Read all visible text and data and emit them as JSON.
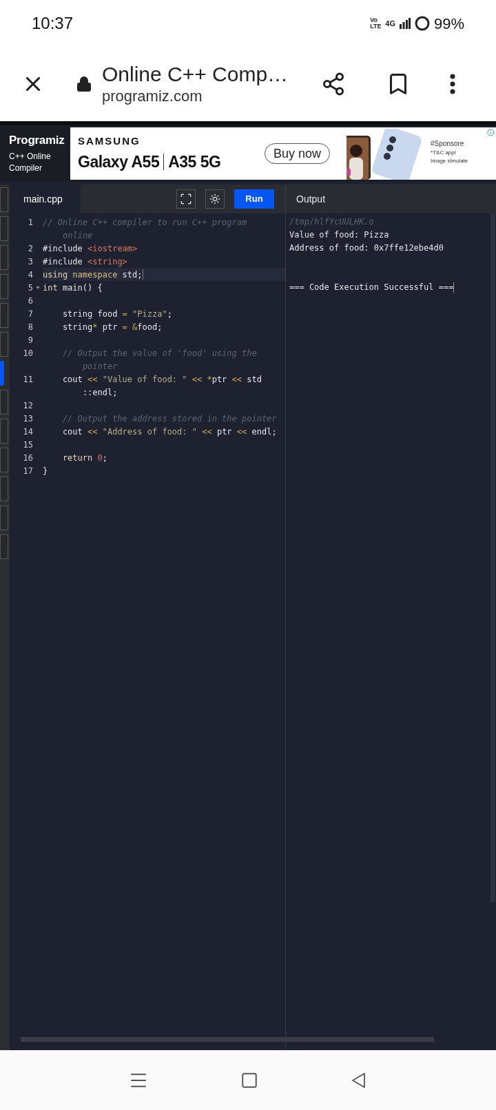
{
  "status_bar": {
    "time": "10:37",
    "volte": "Vo LTE",
    "network": "4G",
    "battery": "99%"
  },
  "browser_bar": {
    "title": "Online C++ Comp…",
    "url": "programiz.com"
  },
  "site_header": {
    "logo": "Programiz",
    "subtitle": "C++ Online Compiler"
  },
  "ad": {
    "brand": "SAMSUNG",
    "model_1": "Galaxy A55",
    "model_2": "A35 5G",
    "button": "Buy now",
    "sponsored": "#Sponsore",
    "terms": "*T&C appl",
    "note": "Image simulate"
  },
  "side_tabs": [
    {
      "selected": false
    },
    {
      "selected": false
    },
    {
      "selected": false
    },
    {
      "selected": false
    },
    {
      "selected": false
    },
    {
      "selected": false
    },
    {
      "selected": true
    },
    {
      "selected": false
    },
    {
      "selected": false
    },
    {
      "selected": false
    },
    {
      "selected": false
    },
    {
      "selected": false
    },
    {
      "selected": false
    }
  ],
  "tabs": [
    {
      "label": "main.cpp",
      "selected": true
    }
  ],
  "run_button": "Run",
  "code_rows": [
    {
      "kind": "line",
      "number": "1",
      "active": false,
      "foldable": false,
      "tokens": [
        {
          "kind": "comment",
          "text": "// Online C++ compiler to run C++ program"
        }
      ]
    },
    {
      "kind": "wrap",
      "active": false,
      "foldable": false,
      "tokens": [
        {
          "kind": "comment",
          "text": "online"
        }
      ]
    },
    {
      "kind": "line",
      "number": "2",
      "active": false,
      "foldable": false,
      "tokens": [
        {
          "kind": "plain",
          "text": "#include "
        },
        {
          "kind": "include",
          "text": "<iostream>"
        }
      ]
    },
    {
      "kind": "line",
      "number": "3",
      "active": false,
      "foldable": false,
      "tokens": [
        {
          "kind": "plain",
          "text": "#include "
        },
        {
          "kind": "include",
          "text": "<string>"
        }
      ]
    },
    {
      "kind": "line",
      "number": "4",
      "active": true,
      "foldable": false,
      "tokens": [
        {
          "kind": "keyword",
          "text": "using "
        },
        {
          "kind": "type",
          "text": "namespace "
        },
        {
          "kind": "plain",
          "text": "std;"
        }
      ]
    },
    {
      "kind": "line",
      "number": "5",
      "active": false,
      "foldable": true,
      "tokens": [
        {
          "kind": "keyword",
          "text": "int "
        },
        {
          "kind": "plain",
          "text": "main() {"
        }
      ]
    },
    {
      "kind": "line",
      "number": "6",
      "active": false,
      "foldable": false,
      "tokens": []
    },
    {
      "kind": "line",
      "number": "7",
      "active": false,
      "foldable": false,
      "tokens": [
        {
          "kind": "plain",
          "text": "    string food "
        },
        {
          "kind": "operator",
          "text": "= "
        },
        {
          "kind": "string",
          "text": "\"Pizza\""
        },
        {
          "kind": "plain",
          "text": ";"
        }
      ]
    },
    {
      "kind": "line",
      "number": "8",
      "active": false,
      "foldable": false,
      "tokens": [
        {
          "kind": "plain",
          "text": "    string"
        },
        {
          "kind": "operator",
          "text": "*"
        },
        {
          "kind": "plain",
          "text": " ptr "
        },
        {
          "kind": "operator",
          "text": "= &"
        },
        {
          "kind": "plain",
          "text": "food;"
        }
      ]
    },
    {
      "kind": "line",
      "number": "9",
      "active": false,
      "foldable": false,
      "tokens": []
    },
    {
      "kind": "line",
      "number": "10",
      "active": false,
      "foldable": false,
      "tokens": [
        {
          "kind": "comment",
          "text": "    // Output the value of 'food' using the"
        }
      ]
    },
    {
      "kind": "wrap",
      "active": false,
      "foldable": false,
      "tokens": [
        {
          "kind": "comment",
          "text": "    pointer"
        }
      ]
    },
    {
      "kind": "line",
      "number": "11",
      "active": false,
      "foldable": false,
      "tokens": [
        {
          "kind": "plain",
          "text": "    cout "
        },
        {
          "kind": "operator",
          "text": "<< "
        },
        {
          "kind": "string",
          "text": "\"Value of food: \""
        },
        {
          "kind": "operator",
          "text": " << *"
        },
        {
          "kind": "plain",
          "text": "ptr "
        },
        {
          "kind": "operator",
          "text": "<<"
        },
        {
          "kind": "plain",
          "text": " std"
        }
      ]
    },
    {
      "kind": "wrap",
      "active": false,
      "foldable": false,
      "tokens": [
        {
          "kind": "plain",
          "text": "    ::endl;"
        }
      ]
    },
    {
      "kind": "line",
      "number": "12",
      "active": false,
      "foldable": false,
      "tokens": []
    },
    {
      "kind": "line",
      "number": "13",
      "active": false,
      "foldable": false,
      "tokens": [
        {
          "kind": "comment",
          "text": "    // Output the address stored in the pointer"
        }
      ]
    },
    {
      "kind": "line",
      "number": "14",
      "active": false,
      "foldable": false,
      "tokens": [
        {
          "kind": "plain",
          "text": "    cout "
        },
        {
          "kind": "operator",
          "text": "<< "
        },
        {
          "kind": "string",
          "text": "\"Address of food: \""
        },
        {
          "kind": "operator",
          "text": " << "
        },
        {
          "kind": "plain",
          "text": "ptr "
        },
        {
          "kind": "operator",
          "text": "<< "
        },
        {
          "kind": "plain",
          "text": "endl;"
        }
      ]
    },
    {
      "kind": "line",
      "number": "15",
      "active": false,
      "foldable": false,
      "tokens": []
    },
    {
      "kind": "line",
      "number": "16",
      "active": false,
      "foldable": false,
      "tokens": [
        {
          "kind": "keyword",
          "text": "    return "
        },
        {
          "kind": "number",
          "text": "0"
        },
        {
          "kind": "plain",
          "text": ";"
        }
      ]
    },
    {
      "kind": "line",
      "number": "17",
      "active": false,
      "foldable": false,
      "tokens": [
        {
          "kind": "plain",
          "text": "}"
        }
      ]
    }
  ],
  "output": {
    "title": "Output",
    "lines": [
      {
        "kind": "path",
        "text": "/tmp/hlfYcUULHK.o"
      },
      {
        "kind": "text",
        "text": "Value of food: Pizza"
      },
      {
        "kind": "text",
        "text": "Address of food: 0x7ffe12ebe4d0"
      },
      {
        "kind": "status",
        "text": "=== Code Execution Successful ==="
      }
    ]
  }
}
